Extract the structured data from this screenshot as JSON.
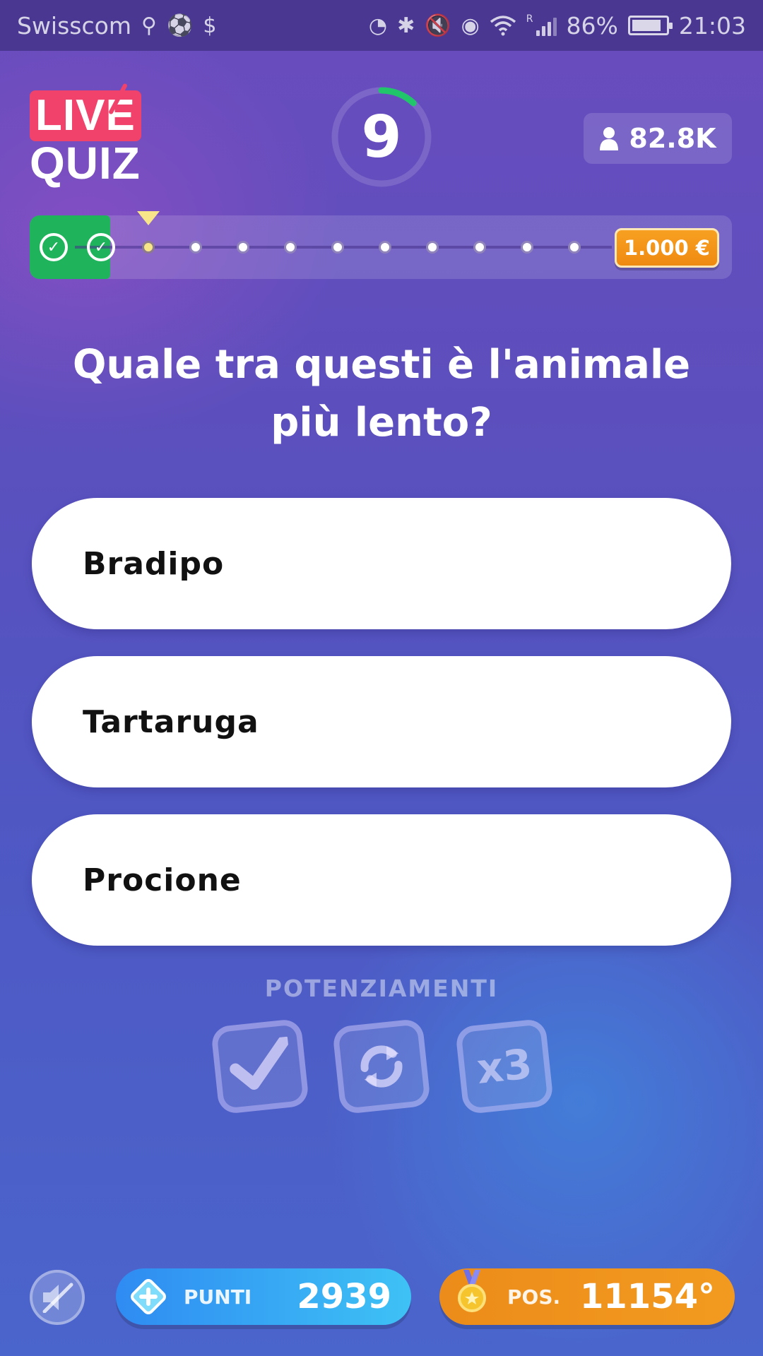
{
  "status_bar": {
    "carrier": "Swisscom",
    "battery": "86%",
    "battery_level": 0.86,
    "signal_label": "R",
    "time": "21:03",
    "left_icons": [
      "usb-icon",
      "soccer-ball-icon",
      "dollar-circle-icon"
    ],
    "right_icons": [
      "data-saver-icon",
      "bluetooth-icon",
      "mute-icon",
      "eye-icon",
      "wifi-icon",
      "signal-icon"
    ]
  },
  "logo": {
    "line1": "LIVE",
    "line2": "QUIZ"
  },
  "timer": {
    "value": "9",
    "progress_fraction": 0.12,
    "ring_color": "#21c66b"
  },
  "viewers": {
    "count": "82.8K"
  },
  "progress": {
    "completed_steps": 2,
    "current_step": 3,
    "total_steps": 12,
    "check_symbol": "✓",
    "prize": "1.000 €"
  },
  "question": {
    "text": "Quale tra questi è l'animale più lento?"
  },
  "answers": [
    "Bradipo",
    "Tartaruga",
    "Procione"
  ],
  "powerups": {
    "title": "POTENZIAMENTI",
    "items": [
      {
        "name": "correct-answer",
        "icon": "check-icon"
      },
      {
        "name": "change-question",
        "icon": "refresh-icon"
      },
      {
        "name": "triple-points",
        "icon": "times-three-icon",
        "label": "x3"
      }
    ]
  },
  "bottom": {
    "points_label": "PUNTI",
    "points_value": "2939",
    "position_label": "POS.",
    "position_value": "11154°"
  },
  "colors": {
    "accent_red": "#f0426b",
    "success_green": "#1fb45c",
    "prize_orange": "#f29a20",
    "points_blue": "#2f8bf2"
  }
}
